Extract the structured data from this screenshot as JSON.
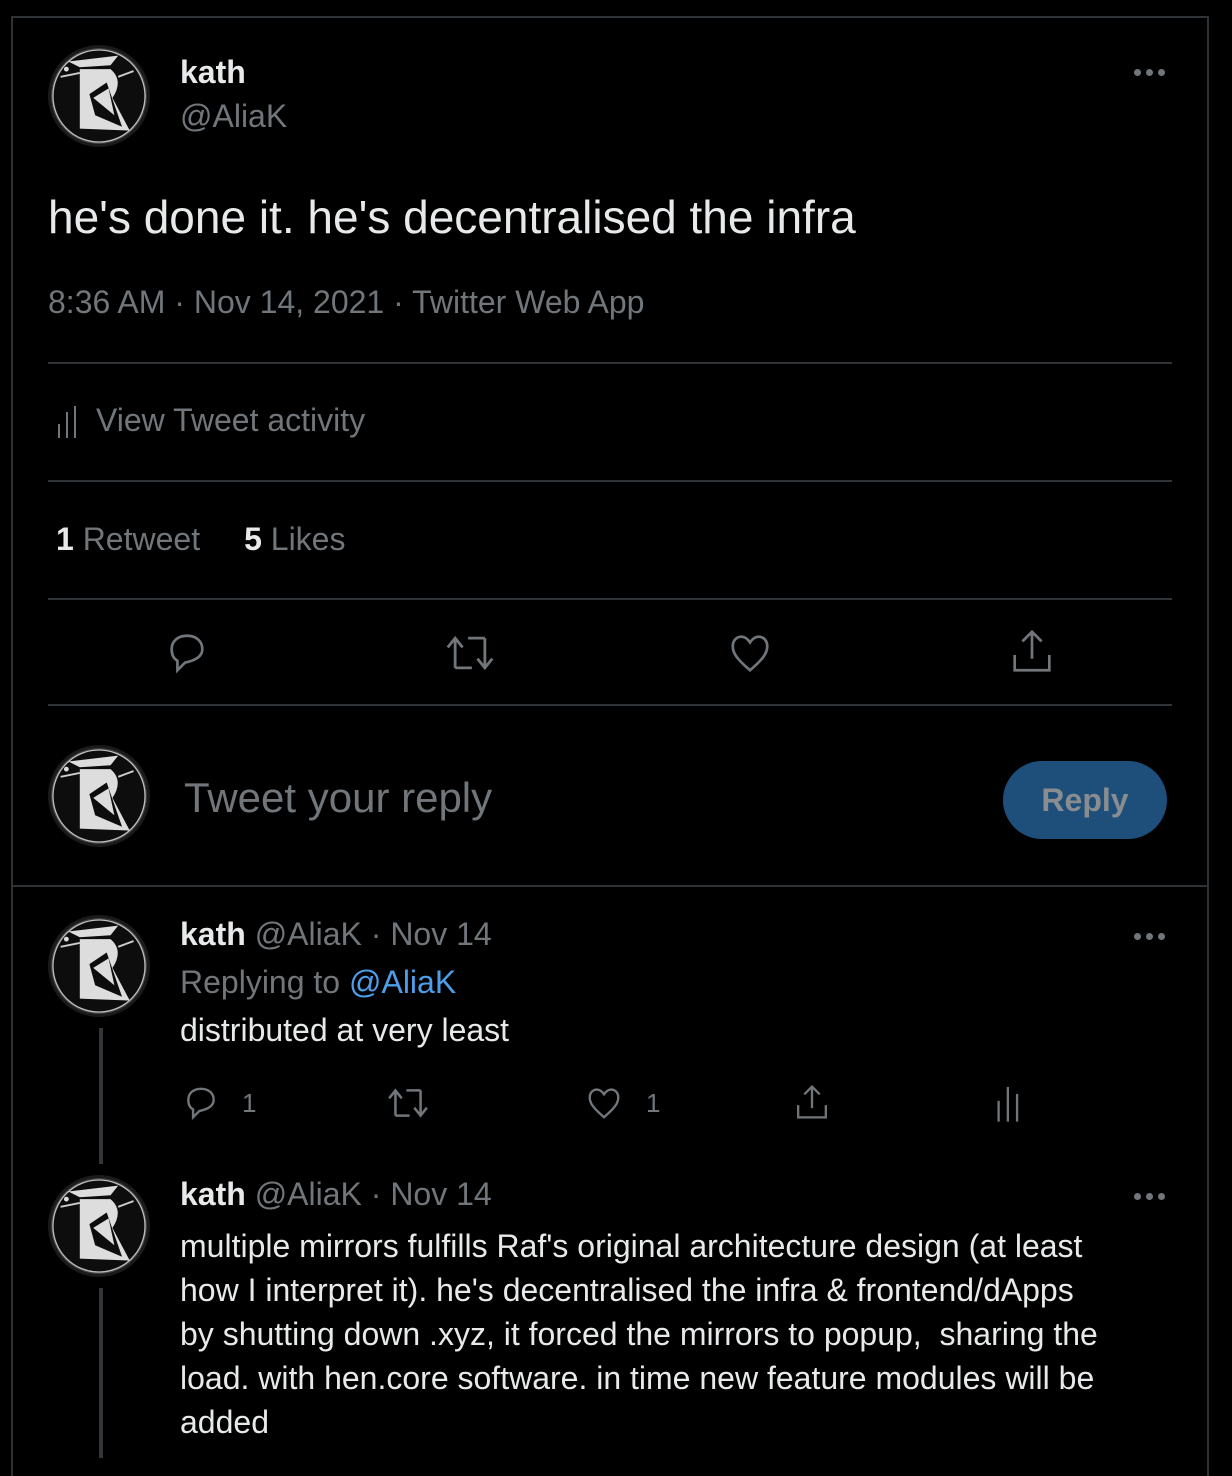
{
  "main_tweet": {
    "author": {
      "display_name": "kath",
      "handle": "@AliaK"
    },
    "text": "he's done it. he's decentralised the infra",
    "time": "8:36 AM",
    "date": "Nov 14, 2021",
    "source": "Twitter Web App",
    "separator": "·",
    "activity_label": "View Tweet activity",
    "stats": {
      "retweets_count": "1",
      "retweets_label": "Retweet",
      "likes_count": "5",
      "likes_label": "Likes"
    },
    "actions": [
      "reply-icon",
      "retweet-icon",
      "like-icon",
      "share-icon"
    ]
  },
  "composer": {
    "placeholder": "Tweet your reply",
    "button_label": "Reply",
    "button_color": "#1d4f7a"
  },
  "replies": [
    {
      "display_name": "kath",
      "handle": "@AliaK",
      "date": "Nov 14",
      "replying_to_label": "Replying to",
      "replying_to_handle": "@AliaK",
      "text": "distributed at very least",
      "reply_count": "1",
      "retweet_count": "",
      "like_count": "1"
    },
    {
      "display_name": "kath",
      "handle": "@AliaK",
      "date": "Nov 14",
      "text_lines": [
        "multiple mirrors fulfills Raf's original architecture design (at least",
        "how I interpret it). he's decentralised the infra & frontend/dApps",
        "by shutting down .xyz, it forced the mirrors to popup,  sharing the",
        "load. with hen.core software. in time new feature modules will be",
        "added"
      ]
    }
  ],
  "colors": {
    "background": "#000000",
    "divider": "#2f3336",
    "secondary_text": "#71767b",
    "link": "#4c9eeb"
  }
}
